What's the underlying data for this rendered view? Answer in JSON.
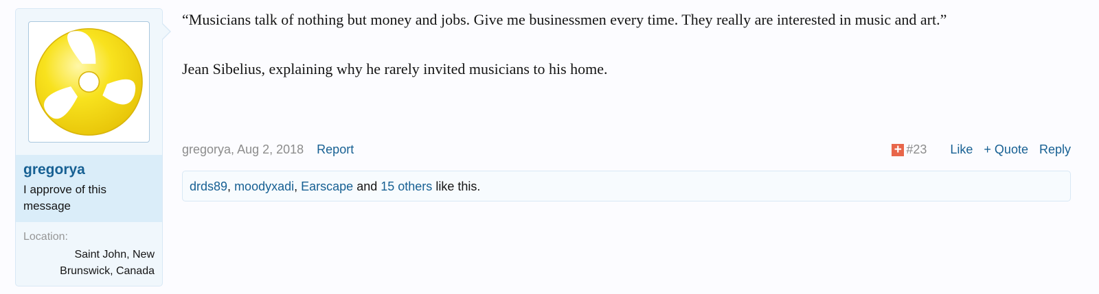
{
  "user": {
    "avatar_icon": "record-adapter-icon",
    "avatar_color": "#f5d80a",
    "username": "gregorya",
    "title": "I approve of this message",
    "location_label": "Location:",
    "location_value": "Saint John, New Brunswick, Canada"
  },
  "post": {
    "paragraphs": [
      "“Musicians talk of nothing but money and jobs. Give me businessmen every time. They really are interested in music and art.”",
      "Jean Sibelius, explaining why he rarely invited musicians to his home."
    ],
    "author": "gregorya",
    "date": "Aug 2, 2018",
    "report_label": "Report",
    "share_icon": "share-plus-icon",
    "post_number": "#23",
    "like_label": "Like",
    "quote_label": "+ Quote",
    "reply_label": "Reply"
  },
  "likes": {
    "users": [
      "drds89",
      "moodyxadi",
      "Earscape"
    ],
    "and_text": "and",
    "others_link": "15 others",
    "suffix": "like this."
  },
  "colors": {
    "link": "#176093",
    "muted": "#8c8c8c",
    "user_box": "#daedf9",
    "share_icon_bg": "#e8664a"
  }
}
